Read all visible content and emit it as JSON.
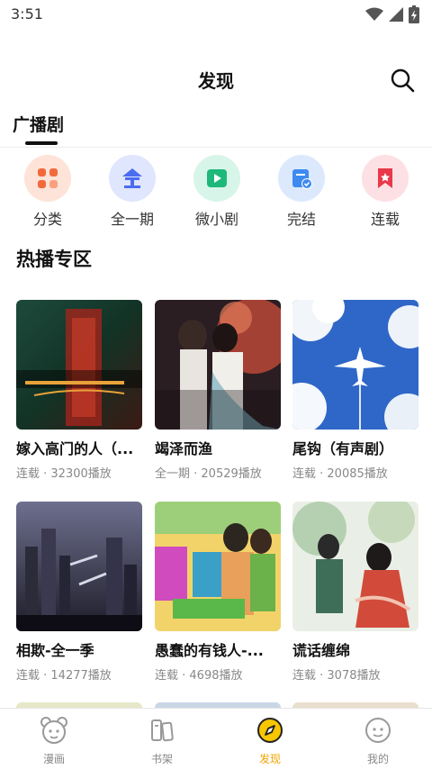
{
  "status": {
    "time": "3:51"
  },
  "header": {
    "title": "发现"
  },
  "tabs": [
    {
      "label": "广播剧"
    }
  ],
  "categories": [
    {
      "label": "分类",
      "icon": "category-icon",
      "color": "#f26a3c",
      "bg": "#fde3d8"
    },
    {
      "label": "全一期",
      "icon": "complete-one-icon",
      "color": "#4a6cf0",
      "bg": "#dfe6fd"
    },
    {
      "label": "微小剧",
      "icon": "play-icon",
      "color": "#1db87a",
      "bg": "#d8f5e9"
    },
    {
      "label": "完结",
      "icon": "finished-icon",
      "color": "#3d8af0",
      "bg": "#dce9fd"
    },
    {
      "label": "连载",
      "icon": "bookmark-icon",
      "color": "#e8384a",
      "bg": "#fde0e3"
    }
  ],
  "section": {
    "title": "热播专区"
  },
  "cards": [
    {
      "title": "嫁入高门的人（...",
      "meta": "连载 · 32300播放"
    },
    {
      "title": "竭泽而渔",
      "meta": "全一期 · 20529播放"
    },
    {
      "title": "尾钩（有声剧）",
      "meta": "连载 · 20085播放"
    },
    {
      "title": "相欺-全一季",
      "meta": "连载 · 14277播放"
    },
    {
      "title": "愚蠢的有钱人-...",
      "meta": "连载 · 4698播放"
    },
    {
      "title": "谎话缠绵",
      "meta": "连载 · 3078播放"
    }
  ],
  "nav": [
    {
      "label": "漫画",
      "icon": "bear-icon",
      "active": false
    },
    {
      "label": "书架",
      "icon": "bookshelf-icon",
      "active": false
    },
    {
      "label": "发现",
      "icon": "compass-icon",
      "active": true
    },
    {
      "label": "我的",
      "icon": "profile-face-icon",
      "active": false
    }
  ],
  "colors": {
    "accent": "#f0a400",
    "text": "#111111",
    "muted": "#888888"
  }
}
